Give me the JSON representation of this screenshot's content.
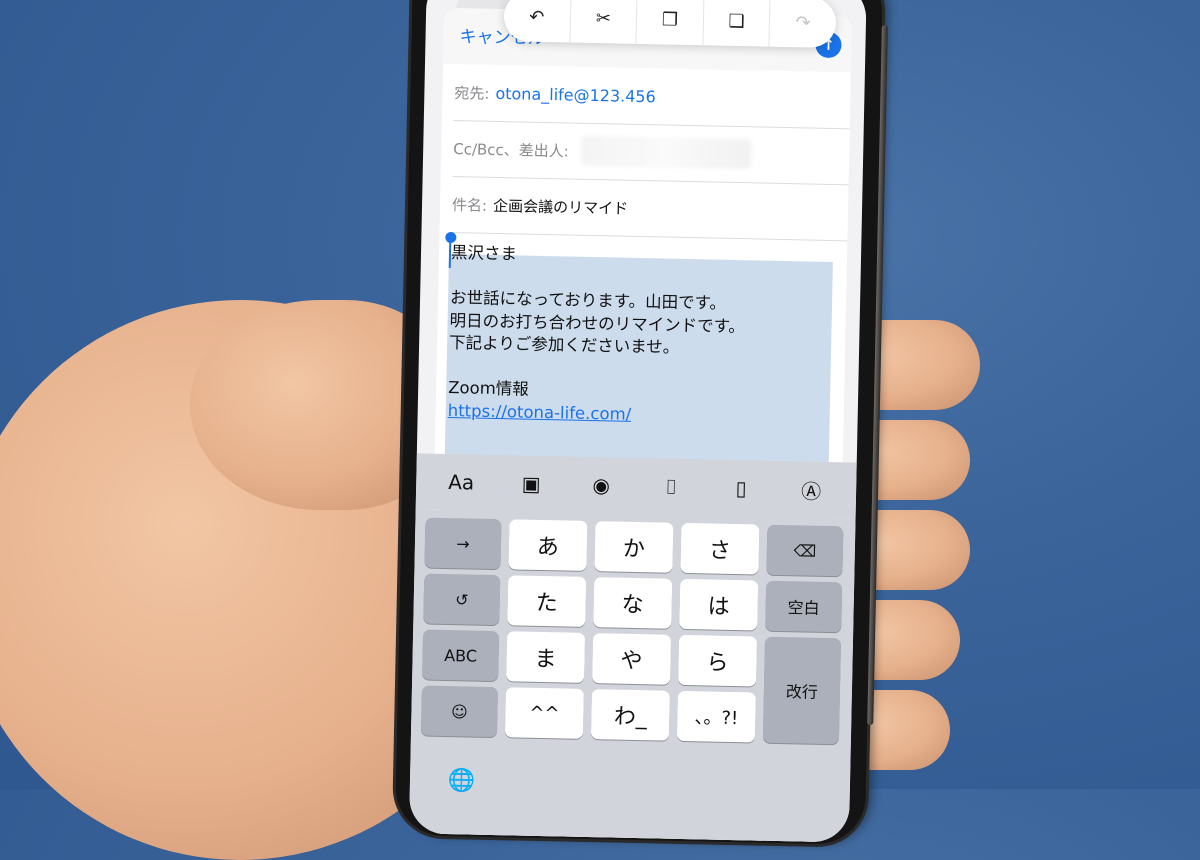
{
  "colors": {
    "accent": "#1a73e8",
    "selection": "#cddcec",
    "background": "#3a649a",
    "keyboard_bg": "#d1d4da"
  },
  "edit_menu": {
    "items": [
      {
        "icon": "undo-icon",
        "glyph": "↶"
      },
      {
        "icon": "scissors-icon",
        "glyph": "✂"
      },
      {
        "icon": "copy-icon",
        "glyph": "❐"
      },
      {
        "icon": "paste-icon",
        "glyph": "❏"
      },
      {
        "icon": "redo-icon",
        "glyph": "↷"
      }
    ]
  },
  "compose": {
    "cancel_label": "キャンセル",
    "send_glyph": "↑",
    "to_label": "宛先:",
    "to_value": "otona_life@123.456",
    "cc_label": "Cc/Bcc、差出人:",
    "subject_label": "件名:",
    "subject_value": "企画会議のリマイド",
    "body": {
      "line1": "黒沢さま",
      "line2": "",
      "line3": "お世話になっております。山田です。",
      "line4": "明日のお打ち合わせのリマインドです。",
      "line5": "下記よりご参加くださいませ。",
      "line6": "",
      "line7": "Zoom情報",
      "link": "https://otona-life.com/"
    }
  },
  "toolbar": {
    "format_label": "Aa",
    "items": [
      {
        "icon": "photo-library-icon",
        "glyph": "▣"
      },
      {
        "icon": "camera-icon",
        "glyph": "◉"
      },
      {
        "icon": "scan-document-icon",
        "glyph": "⌷"
      },
      {
        "icon": "attach-file-icon",
        "glyph": "▯"
      },
      {
        "icon": "markup-icon",
        "glyph": "Ⓐ"
      }
    ]
  },
  "keyboard": {
    "next_glyph": "→",
    "undo_glyph": "↺",
    "abc_label": "ABC",
    "emoji_glyph": "☺",
    "delete_glyph": "⌫",
    "space_label": "空白",
    "return_label": "改行",
    "globe_glyph": "🌐",
    "kana": [
      "あ",
      "か",
      "さ",
      "た",
      "な",
      "は",
      "ま",
      "や",
      "ら",
      "^^",
      "わ_",
      "、。?!"
    ]
  }
}
